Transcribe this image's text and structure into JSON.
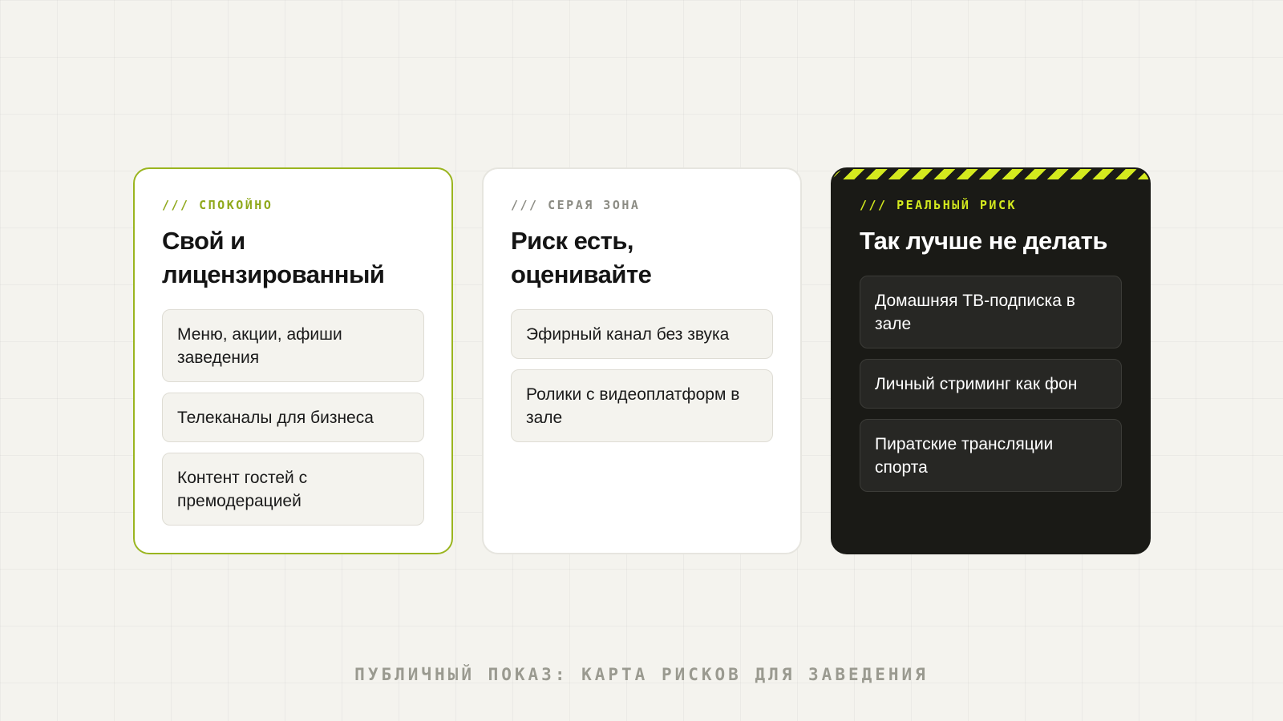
{
  "colors": {
    "background": "#f4f3ee",
    "accent_lime": "#d4ea1e",
    "accent_green": "#8fa81a",
    "dark_card": "#1a1a16",
    "muted_text": "#9a9a90"
  },
  "columns": [
    {
      "tag": "/// СПОКОЙНО",
      "title": "Свой и лицензированный",
      "items": [
        "Меню, акции, афиши заведения",
        "Телеканалы для бизнеса",
        "Контент гостей с премодерацией"
      ]
    },
    {
      "tag": "/// СЕРАЯ ЗОНА",
      "title": "Риск есть, оценивайте",
      "items": [
        "Эфирный канал без звука",
        "Ролики с видеоплатформ в зале"
      ]
    },
    {
      "tag": "/// РЕАЛЬНЫЙ РИСК",
      "title": "Так лучше не делать",
      "items": [
        "Домашняя ТВ-подписка в зале",
        "Личный стриминг как фон",
        "Пиратские трансляции спорта"
      ]
    }
  ],
  "footer": "ПУБЛИЧНЫЙ ПОКАЗ: КАРТА РИСКОВ ДЛЯ ЗАВЕДЕНИЯ"
}
